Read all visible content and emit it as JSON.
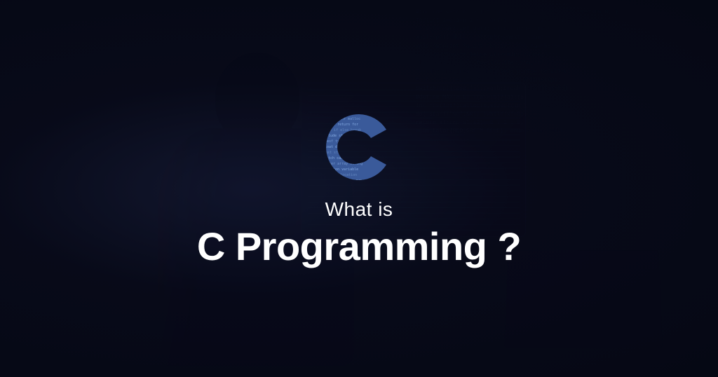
{
  "hero": {
    "subtitle": "What is",
    "title": "C Programming ?",
    "logo_letter": "C"
  },
  "colors": {
    "logo_fill": "#4a6fb8",
    "text": "#ffffff",
    "bg_dark": "#050a15"
  }
}
